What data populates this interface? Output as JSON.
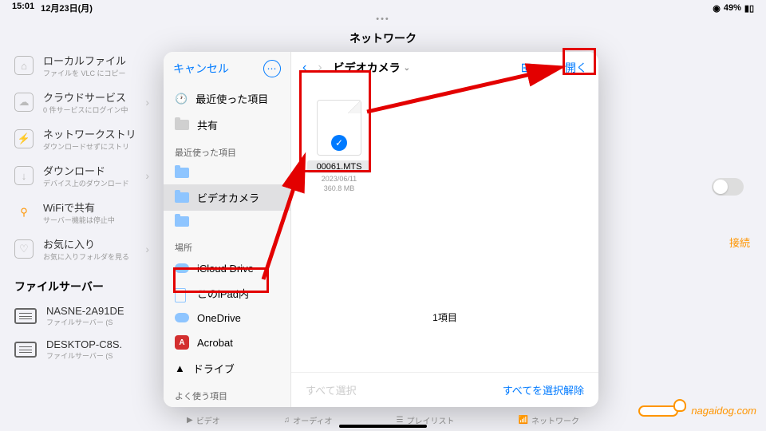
{
  "status": {
    "time": "15:01",
    "date": "12月23日(月)",
    "battery": "49%"
  },
  "header": {
    "title": "ネットワーク"
  },
  "sidebar": {
    "items": [
      {
        "title": "ローカルファイル",
        "sub": "ファイルを VLC にコピー"
      },
      {
        "title": "クラウドサービス",
        "sub": "0 件サービスにログイン中"
      },
      {
        "title": "ネットワークストリ",
        "sub": "ダウンロードせずにストリ"
      },
      {
        "title": "ダウンロード",
        "sub": "デバイス上のダウンロード"
      },
      {
        "title": "WiFiで共有",
        "sub": "サーバー機能は停止中"
      },
      {
        "title": "お気に入り",
        "sub": "お気に入りフォルダを見る"
      }
    ],
    "section": "ファイルサーバー",
    "servers": [
      {
        "title": "NASNE-2A91DE",
        "sub": "ファイルサーバー (S"
      },
      {
        "title": "DESKTOP-C8S.",
        "sub": "ファイルサーバー (S"
      }
    ]
  },
  "connect": "接続",
  "modal": {
    "cancel": "キャンセル",
    "recent": "最近使った項目",
    "shared": "共有",
    "recent_label": "最近使った項目",
    "folders": [
      "",
      "ビデオカメラ",
      ""
    ],
    "loc_label": "場所",
    "locations": [
      "iCloud Drive",
      "このiPad内",
      "OneDrive",
      "Acrobat",
      "ドライブ"
    ],
    "fav_label": "よく使う項目",
    "breadcrumb": "ビデオカメラ",
    "open": "開く",
    "file": {
      "name": "00061.MTS",
      "date": "2023/06/11",
      "size": "360.8 MB"
    },
    "count": "1項目",
    "select_all": "すべて選択",
    "deselect": "すべてを選択解除"
  },
  "tabs": [
    "ビデオ",
    "オーディオ",
    "プレイリスト",
    "ネットワーク"
  ],
  "watermark": "nagaidog.com"
}
